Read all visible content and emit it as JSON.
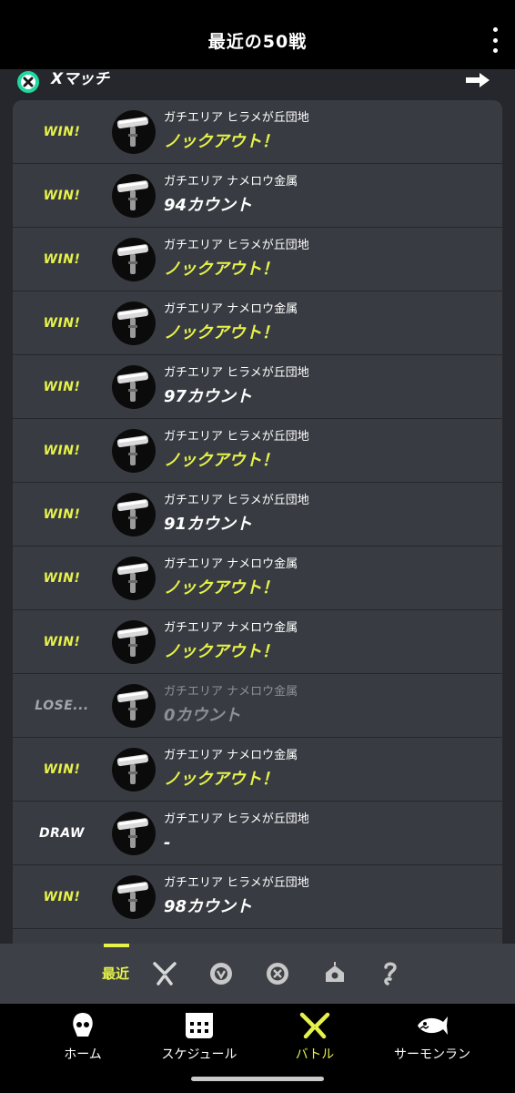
{
  "header": {
    "title": "最近の50戦"
  },
  "subheader": {
    "mode_label": "Xマッチ"
  },
  "colors": {
    "accent": "#e6f24a",
    "background": "#25272c",
    "row_bg": "#383b41"
  },
  "battles": [
    {
      "result": "WIN!",
      "status": "win",
      "stage": "ガチエリア ヒラメが丘団地",
      "outcome": "ノックアウト！",
      "ko": true
    },
    {
      "result": "WIN!",
      "status": "win",
      "stage": "ガチエリア ナメロウ金属",
      "outcome": "94カウント",
      "ko": false
    },
    {
      "result": "WIN!",
      "status": "win",
      "stage": "ガチエリア ヒラメが丘団地",
      "outcome": "ノックアウト！",
      "ko": true
    },
    {
      "result": "WIN!",
      "status": "win",
      "stage": "ガチエリア ナメロウ金属",
      "outcome": "ノックアウト！",
      "ko": true
    },
    {
      "result": "WIN!",
      "status": "win",
      "stage": "ガチエリア ヒラメが丘団地",
      "outcome": "97カウント",
      "ko": false
    },
    {
      "result": "WIN!",
      "status": "win",
      "stage": "ガチエリア ヒラメが丘団地",
      "outcome": "ノックアウト！",
      "ko": true
    },
    {
      "result": "WIN!",
      "status": "win",
      "stage": "ガチエリア ヒラメが丘団地",
      "outcome": "91カウント",
      "ko": false
    },
    {
      "result": "WIN!",
      "status": "win",
      "stage": "ガチエリア ナメロウ金属",
      "outcome": "ノックアウト！",
      "ko": true
    },
    {
      "result": "WIN!",
      "status": "win",
      "stage": "ガチエリア ナメロウ金属",
      "outcome": "ノックアウト！",
      "ko": true
    },
    {
      "result": "LOSE...",
      "status": "lose",
      "stage": "ガチエリア ナメロウ金属",
      "outcome": "0カウント",
      "ko": false
    },
    {
      "result": "WIN!",
      "status": "win",
      "stage": "ガチエリア ナメロウ金属",
      "outcome": "ノックアウト！",
      "ko": true
    },
    {
      "result": "DRAW",
      "status": "draw",
      "stage": "ガチエリア ヒラメが丘団地",
      "outcome": "-",
      "ko": false
    },
    {
      "result": "WIN!",
      "status": "win",
      "stage": "ガチエリア ヒラメが丘団地",
      "outcome": "98カウント",
      "ko": false
    }
  ],
  "filter": {
    "recent_label": "最近",
    "icons": [
      "regular-battle-icon",
      "bankara-battle-icon",
      "x-match-icon",
      "private-match-icon",
      "event-match-icon"
    ]
  },
  "nav": {
    "items": [
      {
        "label": "ホーム",
        "icon": "squid-home-icon"
      },
      {
        "label": "スケジュール",
        "icon": "calendar-icon"
      },
      {
        "label": "バトル",
        "icon": "battle-icon",
        "active": true
      },
      {
        "label": "サーモンラン",
        "icon": "salmon-icon"
      }
    ]
  }
}
